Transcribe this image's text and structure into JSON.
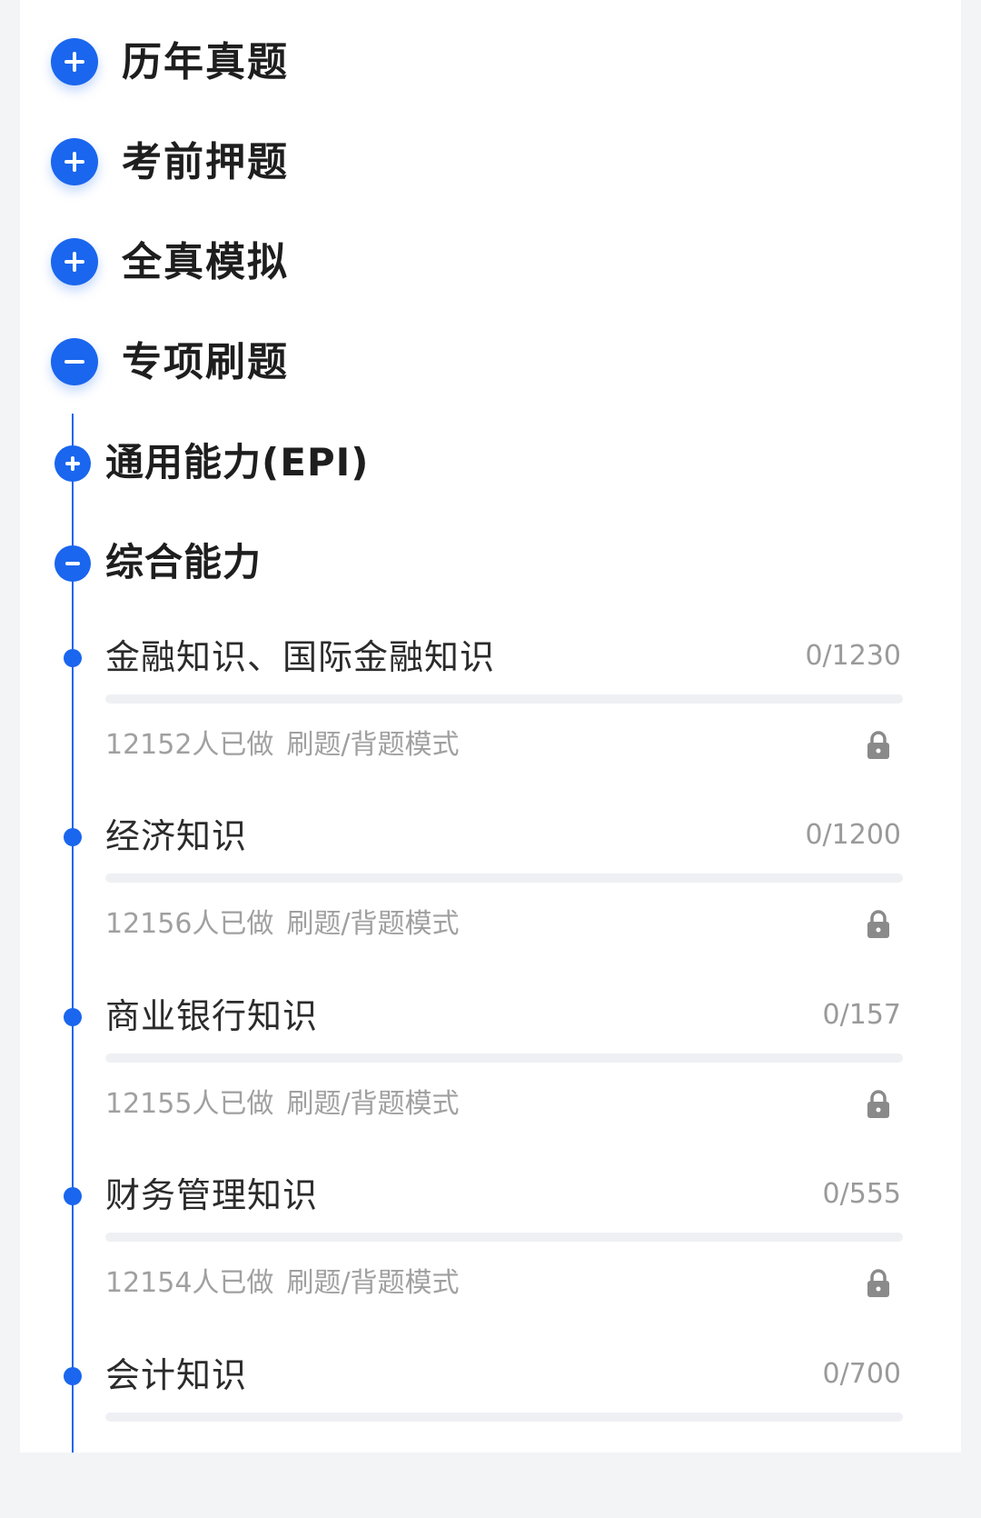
{
  "categories": [
    {
      "label": "历年真题",
      "state": "collapsed",
      "icon": "plus-icon"
    },
    {
      "label": "考前押题",
      "state": "collapsed",
      "icon": "plus-icon"
    },
    {
      "label": "全真模拟",
      "state": "collapsed",
      "icon": "plus-icon"
    },
    {
      "label": "专项刷题",
      "state": "expanded",
      "icon": "minus-icon"
    }
  ],
  "subcategories": [
    {
      "label": "通用能力(EPI)",
      "state": "collapsed",
      "icon": "plus-icon"
    },
    {
      "label": "综合能力",
      "state": "expanded",
      "icon": "minus-icon"
    }
  ],
  "items": [
    {
      "title": "金融知识、国际金融知识",
      "count": "0/1230",
      "progress": 0,
      "done_by": "12152人已做",
      "mode": "刷题/背题模式",
      "icon": "lock-icon"
    },
    {
      "title": "经济知识",
      "count": "0/1200",
      "progress": 0,
      "done_by": "12156人已做",
      "mode": "刷题/背题模式",
      "icon": "lock-icon"
    },
    {
      "title": "商业银行知识",
      "count": "0/157",
      "progress": 0,
      "done_by": "12155人已做",
      "mode": "刷题/背题模式",
      "icon": "lock-icon"
    },
    {
      "title": "财务管理知识",
      "count": "0/555",
      "progress": 0,
      "done_by": "12154人已做",
      "mode": "刷题/背题模式",
      "icon": "lock-icon"
    },
    {
      "title": "会计知识",
      "count": "0/700",
      "progress": 0
    }
  ],
  "colors": {
    "accent": "#1a66ee",
    "title": "#1e1e1e",
    "muted": "#9a9a9a",
    "track": "#eef0f4"
  }
}
